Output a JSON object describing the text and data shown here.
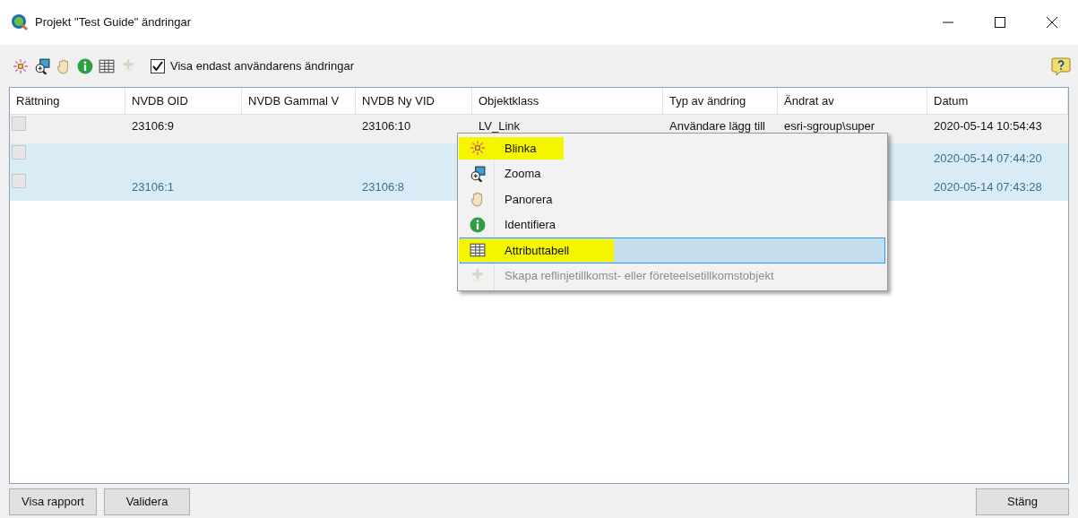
{
  "window": {
    "title": "Projekt \"Test Guide\" ändringar"
  },
  "toolbar": {
    "tools": [
      {
        "kind": "flash",
        "disabled": false
      },
      {
        "kind": "zoom",
        "disabled": false
      },
      {
        "kind": "pan",
        "disabled": false
      },
      {
        "kind": "identify",
        "disabled": false
      },
      {
        "kind": "table",
        "disabled": false
      },
      {
        "kind": "create",
        "disabled": true
      }
    ],
    "filter": {
      "label": "Visa endast användarens ändringar",
      "checked": true
    }
  },
  "table": {
    "columns": [
      "Rättning",
      "NVDB OID",
      "NVDB Gammal V",
      "NVDB Ny VID",
      "Objektklass",
      "Typ av ändring",
      "Ändrat av",
      "Datum"
    ],
    "rows": [
      {
        "selected": false,
        "checked": false,
        "cells": [
          "",
          "23106:9",
          "",
          "23106:10",
          "LV_Link",
          "Användare lägg till",
          "esri-sgroup\\super",
          "2020-05-14 10:54:43"
        ]
      },
      {
        "selected": true,
        "checked": false,
        "cells": [
          "",
          "",
          "",
          "",
          "",
          "",
          "",
          "2020-05-14 07:44:20"
        ]
      },
      {
        "selected": true,
        "checked": false,
        "cells": [
          "",
          "23106:1",
          "",
          "23106:8",
          "",
          "",
          "",
          "2020-05-14 07:43:28"
        ]
      }
    ]
  },
  "context_menu": {
    "items": [
      {
        "kind": "flash",
        "label": "Blinka",
        "selected": false,
        "marked": true,
        "disabled": false
      },
      {
        "kind": "zoom",
        "label": "Zooma",
        "selected": false,
        "marked": false,
        "disabled": false
      },
      {
        "kind": "pan",
        "label": "Panorera",
        "selected": false,
        "marked": false,
        "disabled": false
      },
      {
        "kind": "identify",
        "label": "Identifiera",
        "selected": false,
        "marked": false,
        "disabled": false
      },
      {
        "kind": "table",
        "label": "Attributtabell",
        "selected": true,
        "marked": true,
        "disabled": false
      },
      {
        "kind": "create",
        "label": "Skapa reflinjetillkomst- eller företeelsetillkomstobjekt",
        "selected": false,
        "marked": false,
        "disabled": true
      }
    ]
  },
  "buttons": {
    "left": [
      "Visa rapport",
      "Validera"
    ],
    "right": [
      "Stäng"
    ]
  }
}
